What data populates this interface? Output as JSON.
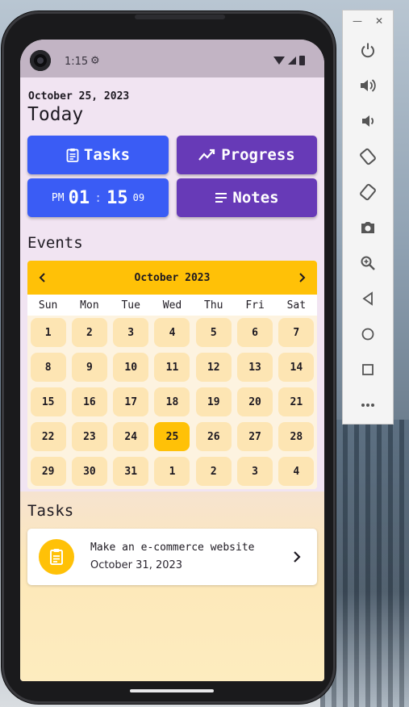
{
  "status_bar": {
    "time": "1:15"
  },
  "header": {
    "date": "October 25, 2023",
    "title": "Today"
  },
  "tiles": {
    "tasks_label": "Tasks",
    "progress_label": "Progress",
    "notes_label": "Notes",
    "clock": {
      "ampm": "PM",
      "hours": "01",
      "separator": ":",
      "minutes": "15",
      "seconds": "09"
    }
  },
  "events": {
    "title": "Events",
    "calendar": {
      "month_label": "October 2023",
      "weekdays": [
        "Sun",
        "Mon",
        "Tue",
        "Wed",
        "Thu",
        "Fri",
        "Sat"
      ],
      "days": [
        "1",
        "2",
        "3",
        "4",
        "5",
        "6",
        "7",
        "8",
        "9",
        "10",
        "11",
        "12",
        "13",
        "14",
        "15",
        "16",
        "17",
        "18",
        "19",
        "20",
        "21",
        "22",
        "23",
        "24",
        "25",
        "26",
        "27",
        "28",
        "29",
        "30",
        "31",
        "1",
        "2",
        "3",
        "4"
      ],
      "selected": "25"
    }
  },
  "tasks": {
    "title": "Tasks",
    "items": [
      {
        "name": "Make an e-commerce website",
        "date": "October 31, 2023"
      }
    ]
  },
  "colors": {
    "accent_blue": "#3a5cf5",
    "accent_purple": "#673ab7",
    "calendar_yellow": "#ffc107",
    "day_chip": "#fde5b3",
    "screen_bg": "#f1e4f2"
  },
  "emulator_toolbar": {
    "icons": [
      "power-icon",
      "volume-up-icon",
      "volume-down-icon",
      "rotate-left-icon",
      "rotate-right-icon",
      "camera-icon",
      "zoom-icon",
      "back-icon",
      "home-icon",
      "overview-icon",
      "more-icon"
    ]
  }
}
